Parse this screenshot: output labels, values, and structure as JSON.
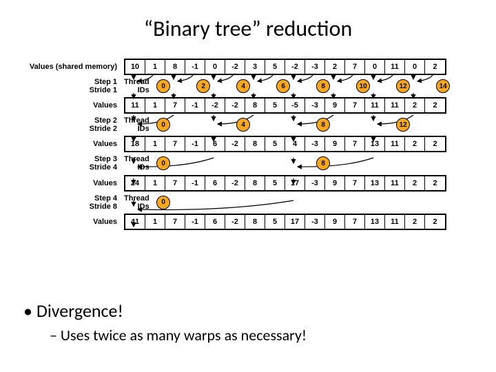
{
  "title": "“Binary tree” reduction",
  "labels": {
    "values_shared": "Values (shared memory)",
    "values": "Values",
    "thread_ids": "Thread\nIDs",
    "steps": [
      {
        "step": "Step 1",
        "stride": "Stride 1"
      },
      {
        "step": "Step 2",
        "stride": "Stride 2"
      },
      {
        "step": "Step 3",
        "stride": "Stride 4"
      },
      {
        "step": "Step 4",
        "stride": "Stride 8"
      }
    ]
  },
  "rows": {
    "values0": [
      10,
      1,
      8,
      -1,
      0,
      -2,
      3,
      5,
      -2,
      -3,
      2,
      7,
      0,
      11,
      0,
      2
    ],
    "tids1": [
      0,
      2,
      4,
      6,
      8,
      10,
      12,
      14
    ],
    "gap1": 2,
    "values1": [
      11,
      1,
      7,
      -1,
      -2,
      -2,
      8,
      5,
      -5,
      -3,
      9,
      7,
      11,
      11,
      2,
      2
    ],
    "tids2": [
      0,
      4,
      8,
      12
    ],
    "gap2": 4,
    "values2": [
      18,
      1,
      7,
      -1,
      6,
      -2,
      8,
      5,
      4,
      -3,
      9,
      7,
      13,
      11,
      2,
      2
    ],
    "tids3": [
      0,
      8
    ],
    "gap3": 8,
    "values3": [
      24,
      1,
      7,
      -1,
      6,
      -2,
      8,
      5,
      17,
      -3,
      9,
      7,
      13,
      11,
      2,
      2
    ],
    "tids4": [
      0
    ],
    "gap4": 16,
    "values4": [
      41,
      1,
      7,
      -1,
      6,
      -2,
      8,
      5,
      17,
      -3,
      9,
      7,
      13,
      11,
      2,
      2
    ]
  },
  "bullets": {
    "main": "Divergence!",
    "sub": "– Uses twice as many warps as necessary!"
  }
}
